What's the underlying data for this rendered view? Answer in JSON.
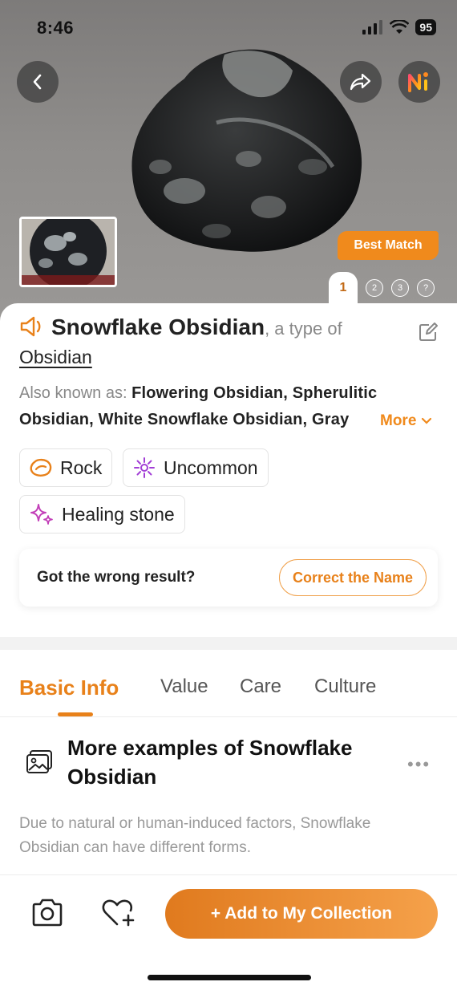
{
  "status": {
    "time": "8:46",
    "battery": "95"
  },
  "hero": {
    "best_match_label": "Best Match",
    "pager": {
      "active": "1",
      "others": [
        "2",
        "3",
        "?"
      ]
    }
  },
  "identification": {
    "name": "Snowflake Obsidian",
    "type_prefix": ", a type of",
    "type_name": "Obsidian",
    "aka_label": "Also known as:",
    "aka_names": "Flowering Obsidian, Spherulitic Obsidian, White Snowflake Obsidian, Gray",
    "more_label": "More"
  },
  "chips": [
    {
      "label": "Rock",
      "icon": "rock-icon",
      "color": "#e8811a"
    },
    {
      "label": "Uncommon",
      "icon": "rarity-icon",
      "color": "#a23fd6"
    },
    {
      "label": "Healing stone",
      "icon": "sparkle-icon",
      "color": "#c23fb8"
    }
  ],
  "feedback": {
    "question": "Got the wrong result?",
    "button": "Correct the Name"
  },
  "tabs": [
    "Basic Info",
    "Value",
    "Care",
    "Culture"
  ],
  "section": {
    "title": "More examples of Snowflake Obsidian",
    "description": "Due to natural or human-induced factors, Snowflake Obsidian can have different forms."
  },
  "bottom": {
    "add_button": "+ Add to My Collection"
  },
  "colors": {
    "accent": "#e8811a",
    "accent_light": "#f5a14a"
  }
}
